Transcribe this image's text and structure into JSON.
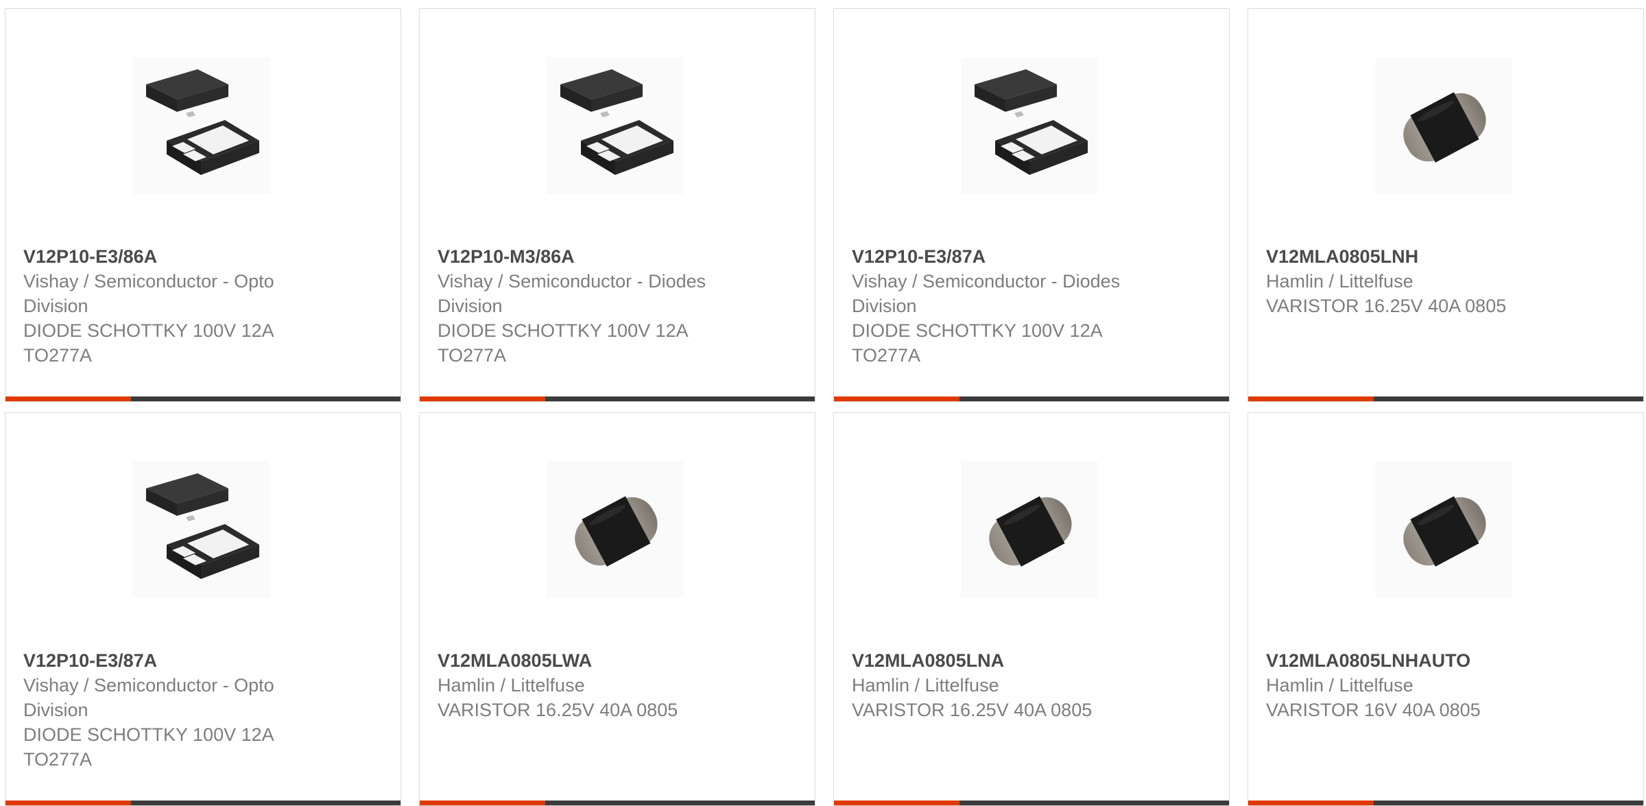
{
  "colors": {
    "accent": "#e03a00",
    "bar": "#3b3b3b",
    "part_number": "#4a4a4a",
    "body_text": "#7d7d7d",
    "card_border": "#dcdcdc"
  },
  "cards": [
    {
      "part_number": "V12P10-E3/86A",
      "manufacturer_line1": "Vishay / Semiconductor - Opto",
      "manufacturer_line2": "Division",
      "description_line1": "DIODE SCHOTTKY 100V 12A",
      "description_line2": "TO277A",
      "image_icon": "to277a-package-icon"
    },
    {
      "part_number": "V12P10-M3/86A",
      "manufacturer_line1": "Vishay / Semiconductor - Diodes",
      "manufacturer_line2": "Division",
      "description_line1": "DIODE SCHOTTKY 100V 12A",
      "description_line2": "TO277A",
      "image_icon": "to277a-package-icon"
    },
    {
      "part_number": "V12P10-E3/87A",
      "manufacturer_line1": "Vishay / Semiconductor - Diodes",
      "manufacturer_line2": "Division",
      "description_line1": "DIODE SCHOTTKY 100V 12A",
      "description_line2": "TO277A",
      "image_icon": "to277a-package-icon"
    },
    {
      "part_number": "V12MLA0805LNH",
      "manufacturer_line1": "Hamlin / Littelfuse",
      "manufacturer_line2": "",
      "description_line1": "VARISTOR 16.25V 40A 0805",
      "description_line2": "",
      "image_icon": "varistor-0805-icon"
    },
    {
      "part_number": "V12P10-E3/87A",
      "manufacturer_line1": "Vishay / Semiconductor - Opto",
      "manufacturer_line2": "Division",
      "description_line1": "DIODE SCHOTTKY 100V 12A",
      "description_line2": "TO277A",
      "image_icon": "to277a-package-icon"
    },
    {
      "part_number": "V12MLA0805LWA",
      "manufacturer_line1": "Hamlin / Littelfuse",
      "manufacturer_line2": "",
      "description_line1": "VARISTOR 16.25V 40A 0805",
      "description_line2": "",
      "image_icon": "varistor-0805-icon"
    },
    {
      "part_number": "V12MLA0805LNA",
      "manufacturer_line1": "Hamlin / Littelfuse",
      "manufacturer_line2": "",
      "description_line1": "VARISTOR 16.25V 40A 0805",
      "description_line2": "",
      "image_icon": "varistor-0805-icon"
    },
    {
      "part_number": "V12MLA0805LNHAUTO",
      "manufacturer_line1": "Hamlin / Littelfuse",
      "manufacturer_line2": "",
      "description_line1": "VARISTOR 16V 40A 0805",
      "description_line2": "",
      "image_icon": "varistor-0805-icon"
    }
  ]
}
